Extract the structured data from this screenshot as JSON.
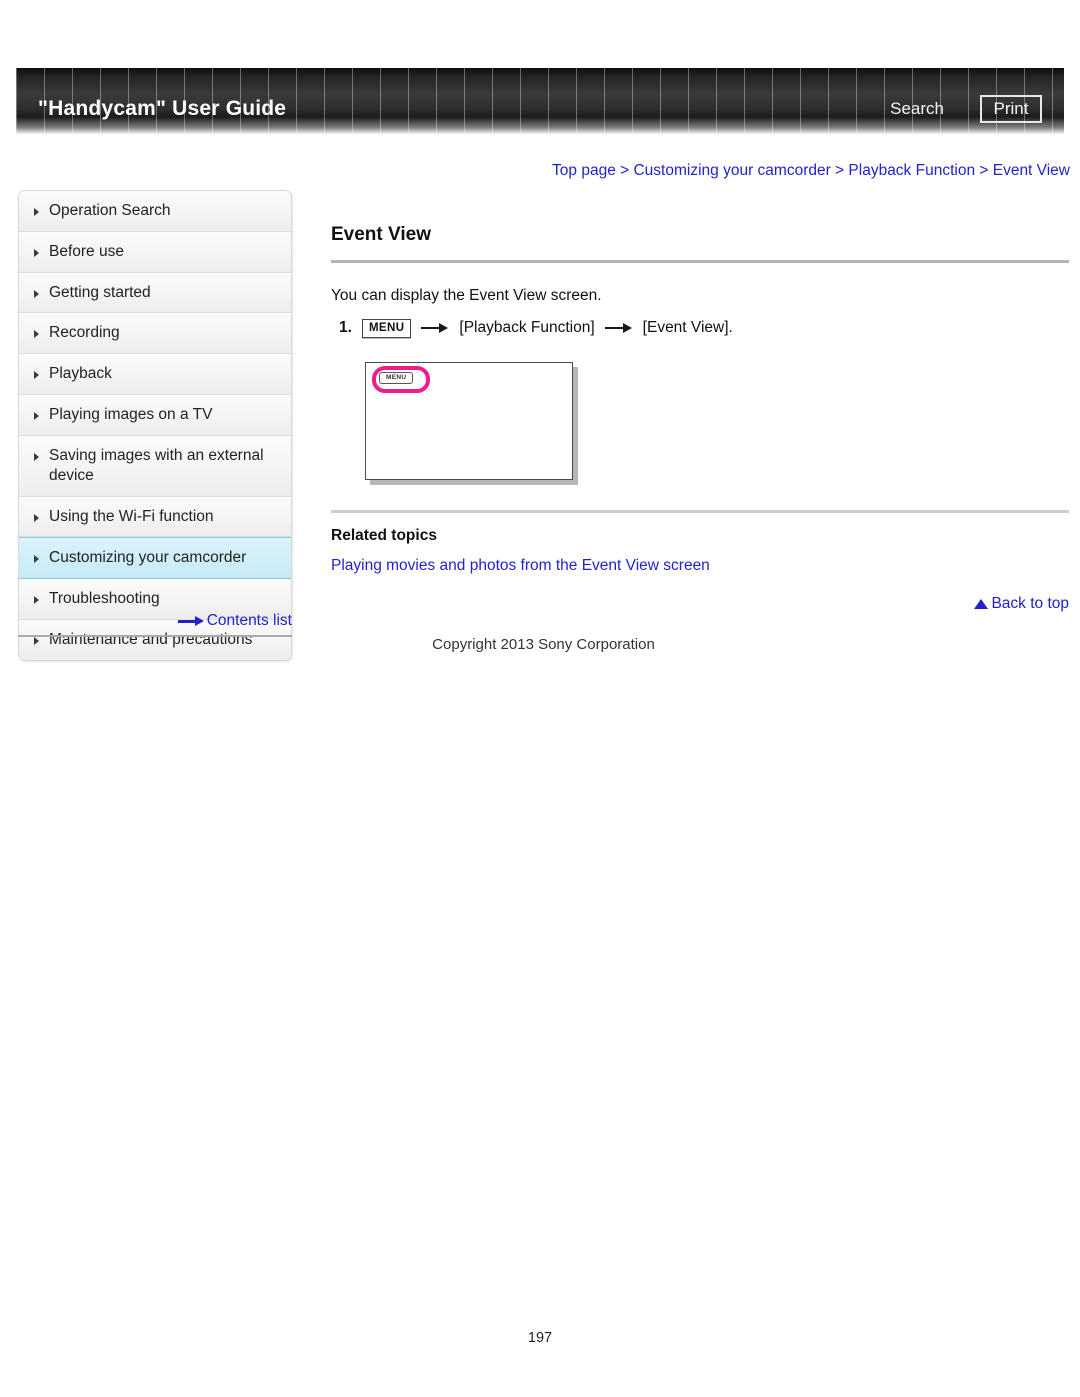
{
  "header": {
    "title": "\"Handycam\" User Guide",
    "search_label": "Search",
    "print_label": "Print"
  },
  "breadcrumb": {
    "text": "Top page > Customizing your camcorder > Playback Function > Event View",
    "items": [
      "Top page",
      "Customizing your camcorder",
      "Playback Function",
      "Event View"
    ],
    "separator": ">"
  },
  "sidebar": {
    "items": [
      {
        "label": "Operation Search",
        "active": false
      },
      {
        "label": "Before use",
        "active": false
      },
      {
        "label": "Getting started",
        "active": false
      },
      {
        "label": "Recording",
        "active": false
      },
      {
        "label": "Playback",
        "active": false
      },
      {
        "label": "Playing images on a TV",
        "active": false
      },
      {
        "label": "Saving images with an external device",
        "active": false
      },
      {
        "label": "Using the Wi-Fi function",
        "active": false
      },
      {
        "label": "Customizing your camcorder",
        "active": true
      },
      {
        "label": "Troubleshooting",
        "active": false
      },
      {
        "label": "Maintenance and precautions",
        "active": false
      }
    ],
    "contents_link": "Contents list",
    "highlight_color": "#cfeef8"
  },
  "main": {
    "title": "Event View",
    "intro": "You can display the Event View screen.",
    "step": {
      "number": "1.",
      "menu_chip": "MENU",
      "target_1": "[Playback Function]",
      "target_2": "[Event View]."
    },
    "figure": {
      "menu_button_label": "MENU",
      "highlight_color": "#ee1d8f"
    },
    "related_topics_title": "Related topics",
    "related_links": [
      "Playing movies and photos from the Event View screen"
    ],
    "back_to_top": "Back to top"
  },
  "footer": {
    "copyright": "Copyright 2013 Sony Corporation",
    "page_number": "197"
  }
}
